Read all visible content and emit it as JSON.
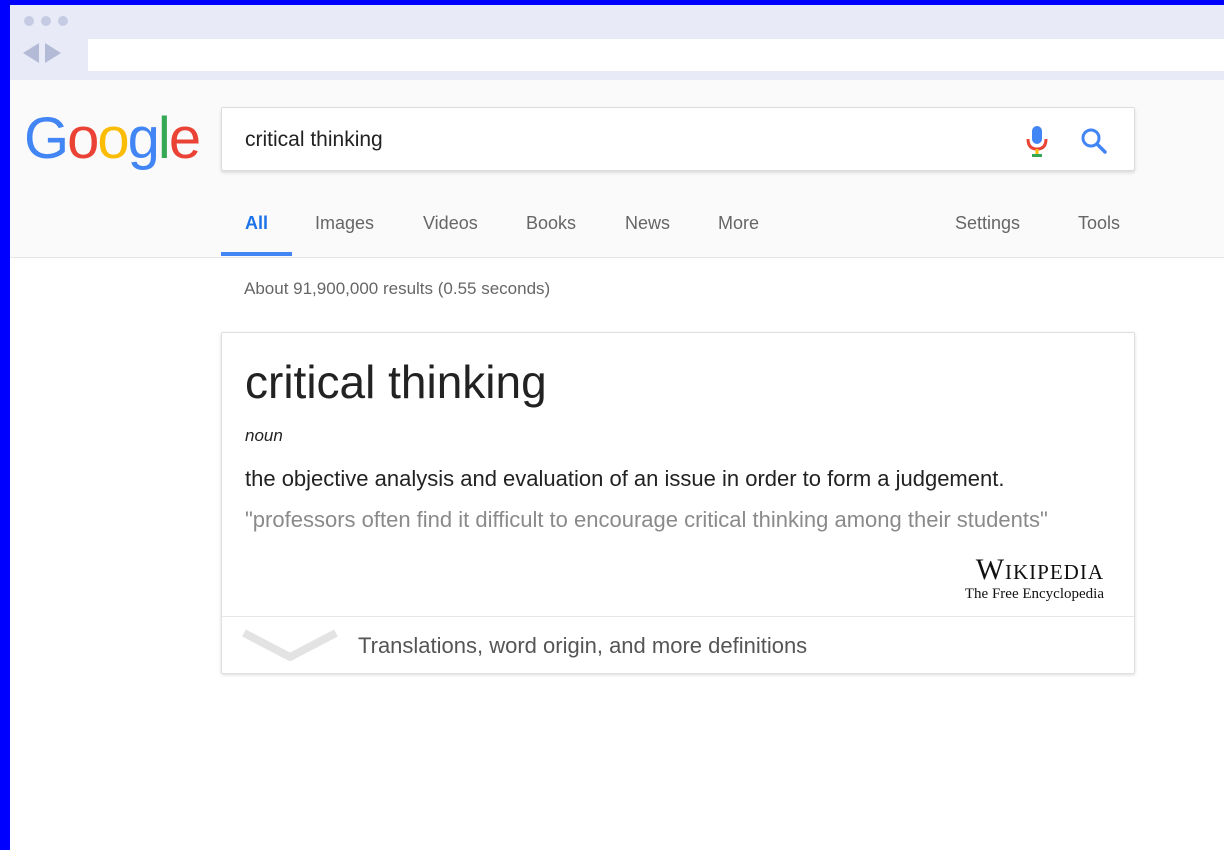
{
  "search": {
    "query": "critical thinking"
  },
  "logo": {
    "letters": [
      {
        "char": "G",
        "color": "#4285F4"
      },
      {
        "char": "o",
        "color": "#EA4335"
      },
      {
        "char": "o",
        "color": "#FBBC05"
      },
      {
        "char": "g",
        "color": "#4285F4"
      },
      {
        "char": "l",
        "color": "#34A853"
      },
      {
        "char": "e",
        "color": "#EA4335"
      }
    ]
  },
  "tabs": {
    "all": "All",
    "images": "Images",
    "videos": "Videos",
    "books": "Books",
    "news": "News",
    "more": "More",
    "settings": "Settings",
    "tools": "Tools"
  },
  "results": {
    "stats": "About 91,900,000 results (0.55 seconds)"
  },
  "definition_card": {
    "word": "critical thinking",
    "part_of_speech": "noun",
    "definition": "the objective analysis and evaluation of an issue in order to form a judgement.",
    "example": "\"professors often find it difficult to encourage critical thinking among their students\"",
    "source_name": "Wikipedia",
    "source_tagline": "The Free Encyclopedia",
    "more_link": "Translations, word origin, and more definitions"
  },
  "colors": {
    "accent": "#4285F4",
    "frame_border": "#0000FF",
    "chrome": "#E8EBF7"
  },
  "icons": {
    "mic": "microphone-icon",
    "search": "search-icon",
    "expand": "chevron-down-icon"
  }
}
